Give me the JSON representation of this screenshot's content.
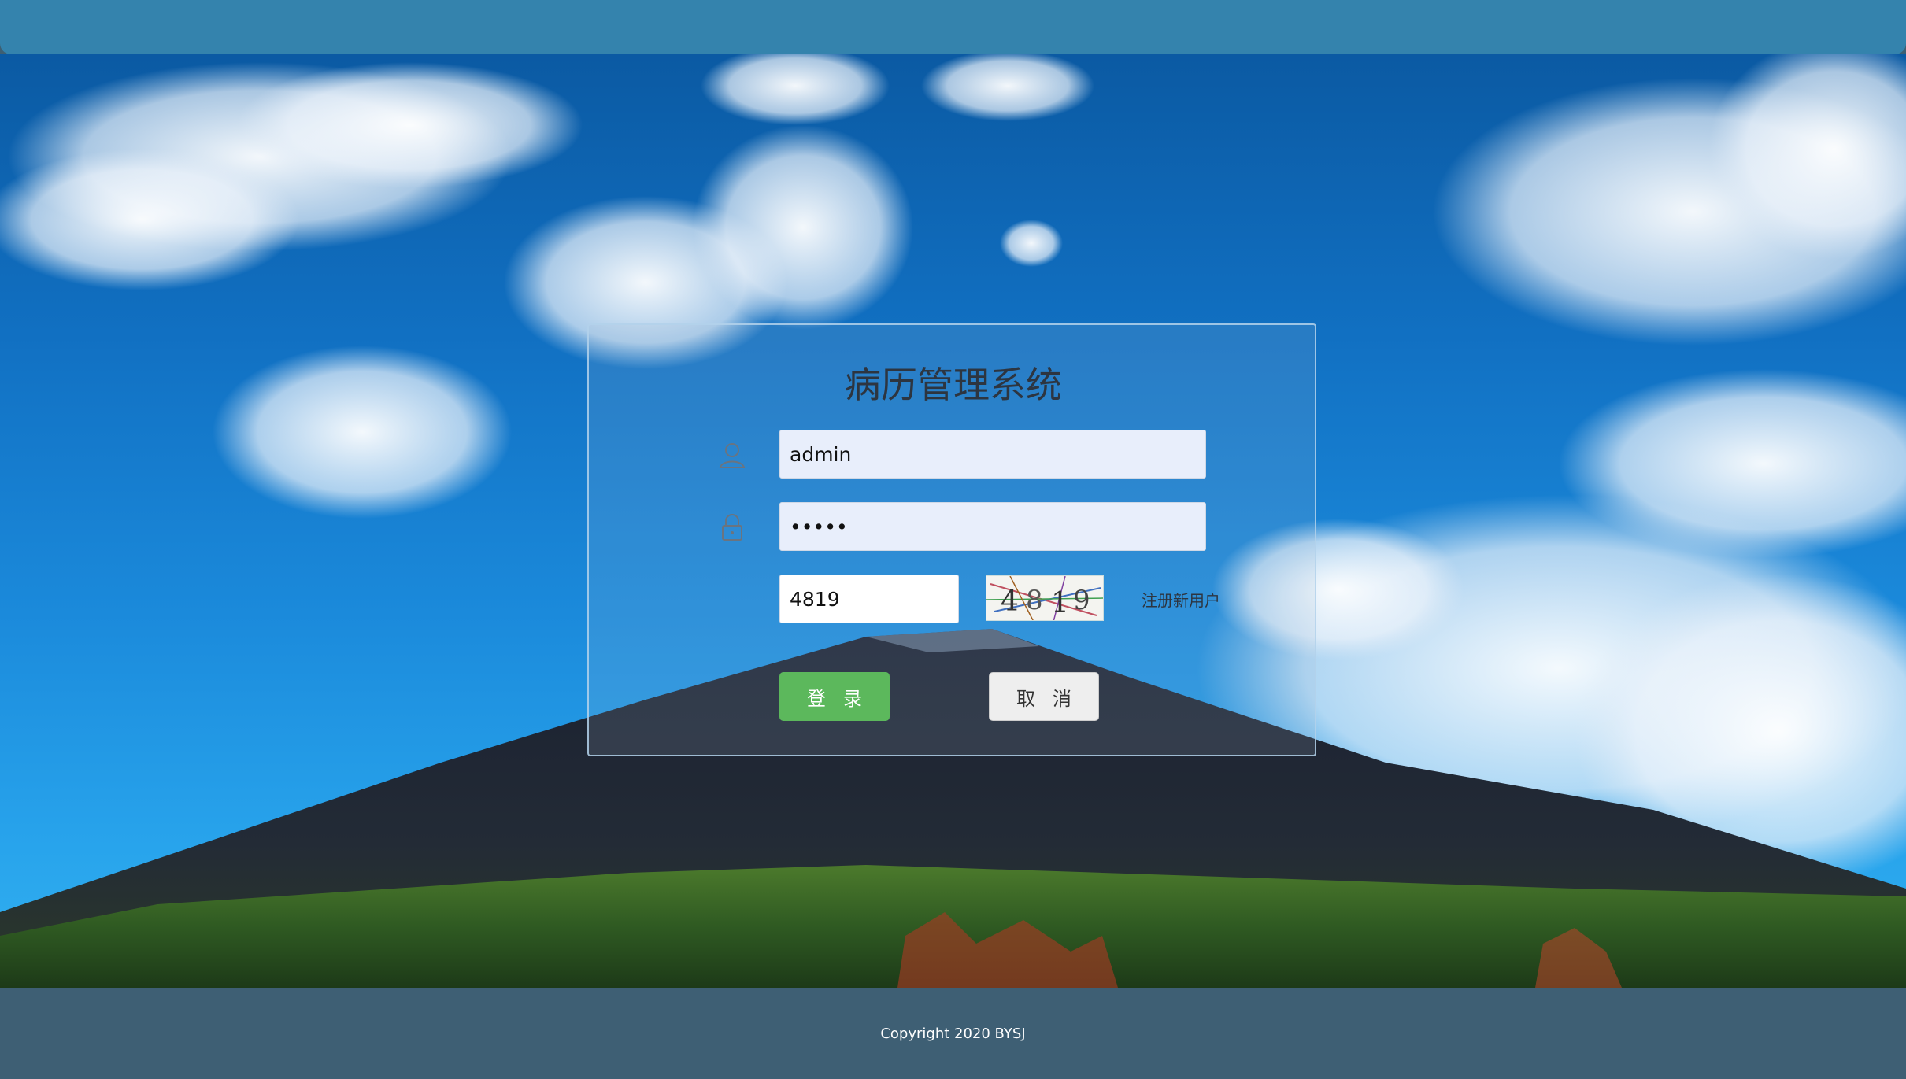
{
  "login": {
    "title": "病历管理系统",
    "username": {
      "value": "admin",
      "icon": "user-icon"
    },
    "password": {
      "value": "•••••",
      "icon": "lock-icon"
    },
    "captcha_input": {
      "value": "4819"
    },
    "captcha_image": {
      "text": "4819"
    },
    "register_label": "注册新用户",
    "login_button": "登录",
    "cancel_button": "取消"
  },
  "footer": {
    "copyright": "Copyright 2020 BYSJ"
  },
  "colors": {
    "topbar": "#3483ad",
    "footer": "#3e5f74",
    "login_button": "#5cb85c",
    "cancel_button": "#eeeeee"
  }
}
